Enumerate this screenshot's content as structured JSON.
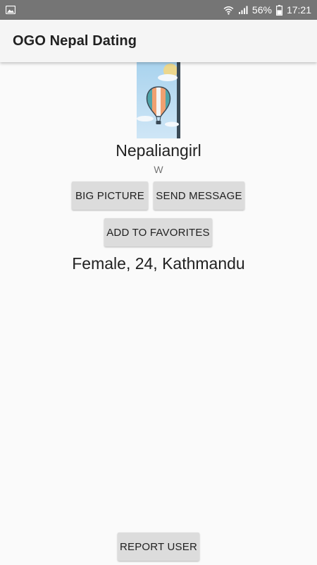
{
  "status_bar": {
    "battery_percent": "56%",
    "time": "17:21",
    "icons": [
      "image-icon",
      "wifi-icon",
      "signal-icon",
      "battery-icon"
    ]
  },
  "app_bar": {
    "title": "OGO Nepal Dating"
  },
  "profile": {
    "photo_icon": "hot-air-balloon-icon",
    "username": "Nepaliangirl",
    "status": "W",
    "details": "Female, 24, Kathmandu"
  },
  "actions": {
    "big_picture": "BIG PICTURE",
    "send_message": "SEND MESSAGE",
    "add_to_favorites": "ADD TO FAVORITES",
    "report_user": "REPORT USER"
  },
  "colors": {
    "status_bar": "#757575",
    "app_bar": "#f5f5f5",
    "background": "#fafafa",
    "button": "#dcdcdc",
    "balloon_orange": "#f0a070",
    "balloon_teal": "#4fa3a8"
  }
}
